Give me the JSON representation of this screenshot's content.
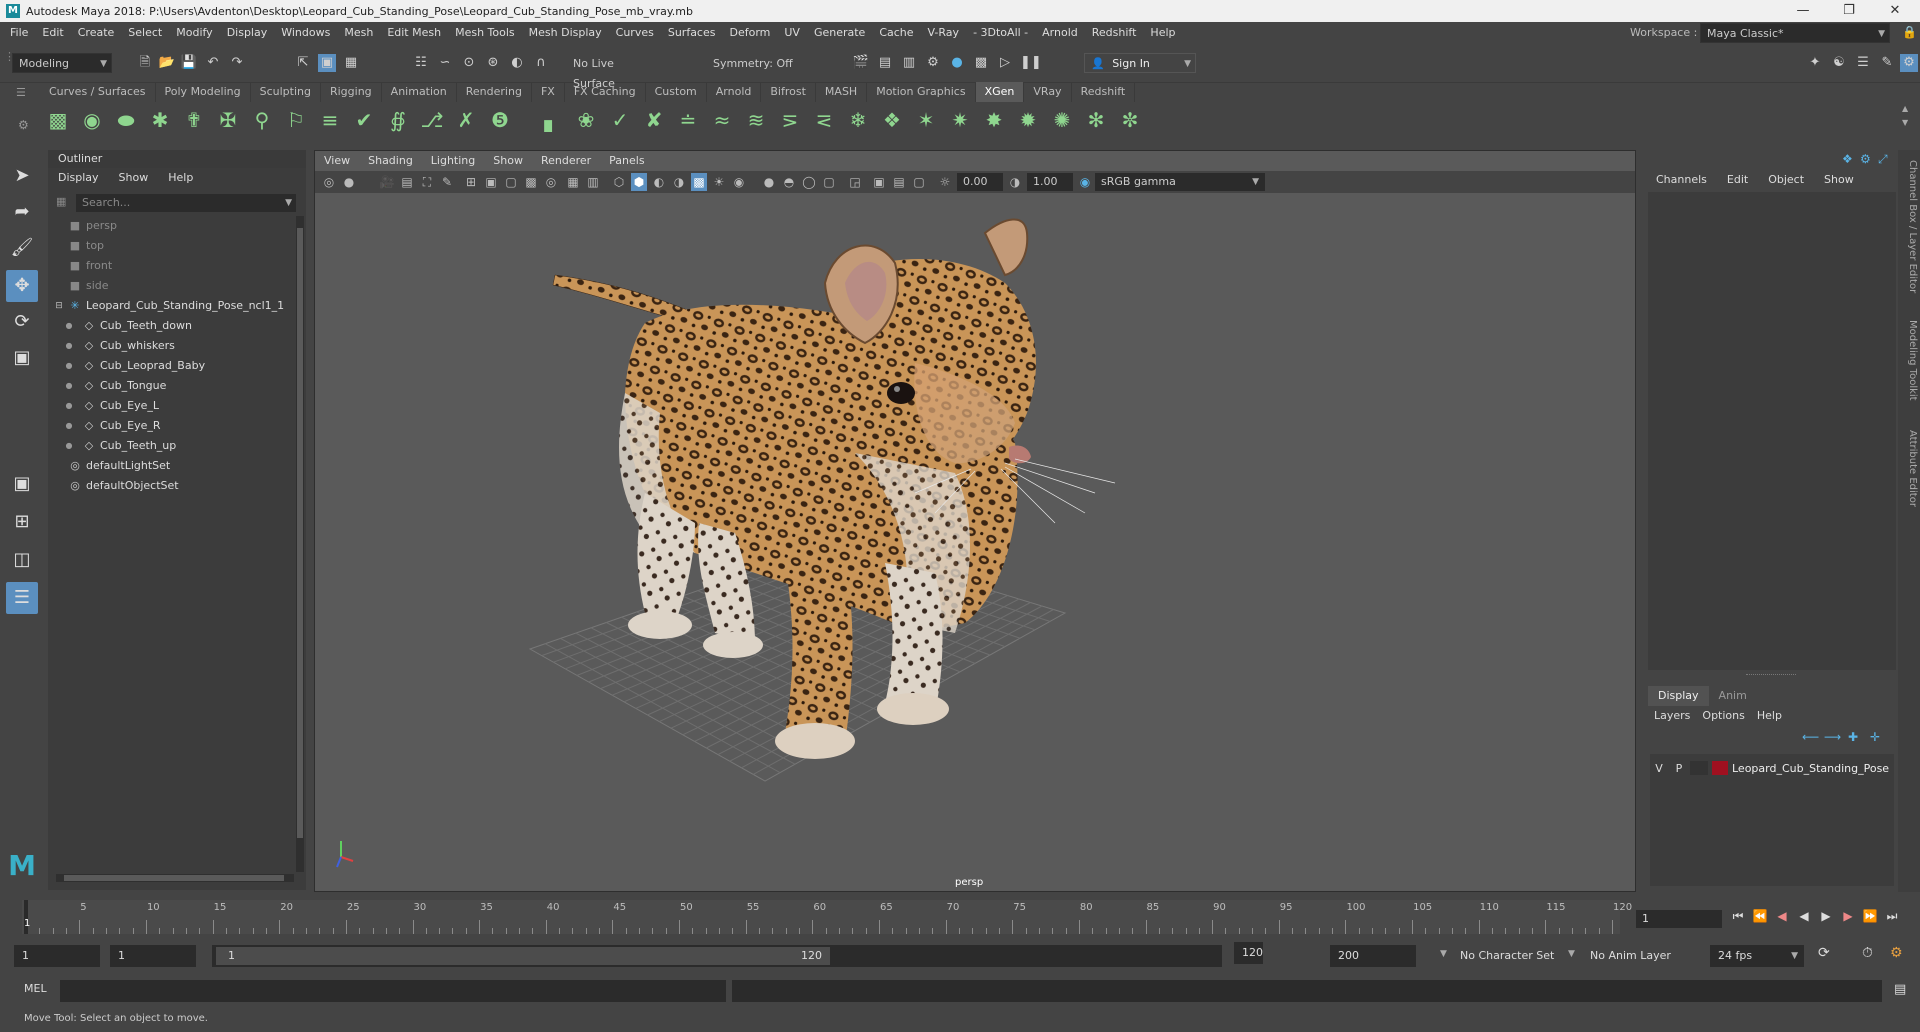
{
  "window": {
    "title": "Autodesk Maya 2018: P:\\Users\\Avdenton\\Desktop\\Leopard_Cub_Standing_Pose\\Leopard_Cub_Standing_Pose_mb_vray.mb",
    "logo": "M"
  },
  "menu": [
    "File",
    "Edit",
    "Create",
    "Select",
    "Modify",
    "Display",
    "Windows",
    "Mesh",
    "Edit Mesh",
    "Mesh Tools",
    "Mesh Display",
    "Curves",
    "Surfaces",
    "Deform",
    "UV",
    "Generate",
    "Cache",
    "V-Ray",
    "- 3DtoAll -",
    "Arnold",
    "Redshift",
    "Help"
  ],
  "workspace": {
    "label": "Workspace :",
    "value": "Maya Classic*"
  },
  "statusline": {
    "mode": "Modeling",
    "live_surface": "No Live Surface",
    "symmetry": "Symmetry: Off",
    "sign_in": "Sign In"
  },
  "shelf": {
    "tabs": [
      "Curves / Surfaces",
      "Poly Modeling",
      "Sculpting",
      "Rigging",
      "Animation",
      "Rendering",
      "FX",
      "FX Caching",
      "Custom",
      "Arnold",
      "Bifrost",
      "MASH",
      "Motion Graphics",
      "XGen",
      "VRay",
      "Redshift"
    ],
    "active": "XGen"
  },
  "outliner": {
    "title": "Outliner",
    "menu": [
      "Display",
      "Show",
      "Help"
    ],
    "search_placeholder": "Search...",
    "items": [
      {
        "label": "persp",
        "indent": 0,
        "dim": true,
        "icon": "camera-icon"
      },
      {
        "label": "top",
        "indent": 0,
        "dim": true,
        "icon": "camera-icon"
      },
      {
        "label": "front",
        "indent": 0,
        "dim": true,
        "icon": "camera-icon"
      },
      {
        "label": "side",
        "indent": 0,
        "dim": true,
        "icon": "camera-icon"
      },
      {
        "label": "Leopard_Cub_Standing_Pose_ncl1_1",
        "indent": 0,
        "dim": false,
        "icon": "group-icon",
        "expanded": true
      },
      {
        "label": "Cub_Teeth_down",
        "indent": 1,
        "dim": false,
        "icon": "mesh-icon"
      },
      {
        "label": "Cub_whiskers",
        "indent": 1,
        "dim": false,
        "icon": "mesh-icon"
      },
      {
        "label": "Cub_Leoprad_Baby",
        "indent": 1,
        "dim": false,
        "icon": "mesh-icon"
      },
      {
        "label": "Cub_Tongue",
        "indent": 1,
        "dim": false,
        "icon": "mesh-icon"
      },
      {
        "label": "Cub_Eye_L",
        "indent": 1,
        "dim": false,
        "icon": "mesh-icon"
      },
      {
        "label": "Cub_Eye_R",
        "indent": 1,
        "dim": false,
        "icon": "mesh-icon"
      },
      {
        "label": "Cub_Teeth_up",
        "indent": 1,
        "dim": false,
        "icon": "mesh-icon"
      },
      {
        "label": "defaultLightSet",
        "indent": 0,
        "dim": false,
        "icon": "set-icon"
      },
      {
        "label": "defaultObjectSet",
        "indent": 0,
        "dim": false,
        "icon": "set-icon"
      }
    ]
  },
  "viewport": {
    "menu": [
      "View",
      "Shading",
      "Lighting",
      "Show",
      "Renderer",
      "Panels"
    ],
    "field_a": "0.00",
    "field_b": "1.00",
    "color_space": "sRGB gamma",
    "camera_label": "persp"
  },
  "channelbox": {
    "menu": [
      "Channels",
      "Edit",
      "Object",
      "Show"
    ],
    "layer_tabs": [
      "Display",
      "Anim"
    ],
    "layer_menu": [
      "Layers",
      "Options",
      "Help"
    ],
    "layer": {
      "v": "V",
      "p": "P",
      "name": "Leopard_Cub_Standing_Pose",
      "color": "#a01020"
    },
    "side_tabs": [
      "Channel Box / Layer Editor",
      "Modeling Toolkit",
      "Attribute Editor"
    ]
  },
  "timeline": {
    "start": 1,
    "end": 120,
    "ticks": [
      5,
      10,
      15,
      20,
      25,
      30,
      35,
      40,
      45,
      50,
      55,
      60,
      65,
      70,
      75,
      80,
      85,
      90,
      95,
      100,
      105,
      110,
      115,
      120
    ],
    "current_frame": "1"
  },
  "range": {
    "start_field": "1",
    "start_field2": "1",
    "slider_start": "1",
    "slider_end": "120",
    "end_field": "120",
    "end_field2": "200",
    "character_set": "No Character Set",
    "anim_layer": "No Anim Layer",
    "fps": "24 fps"
  },
  "command": {
    "label": "MEL"
  },
  "help_line": "Move Tool: Select an object to move."
}
